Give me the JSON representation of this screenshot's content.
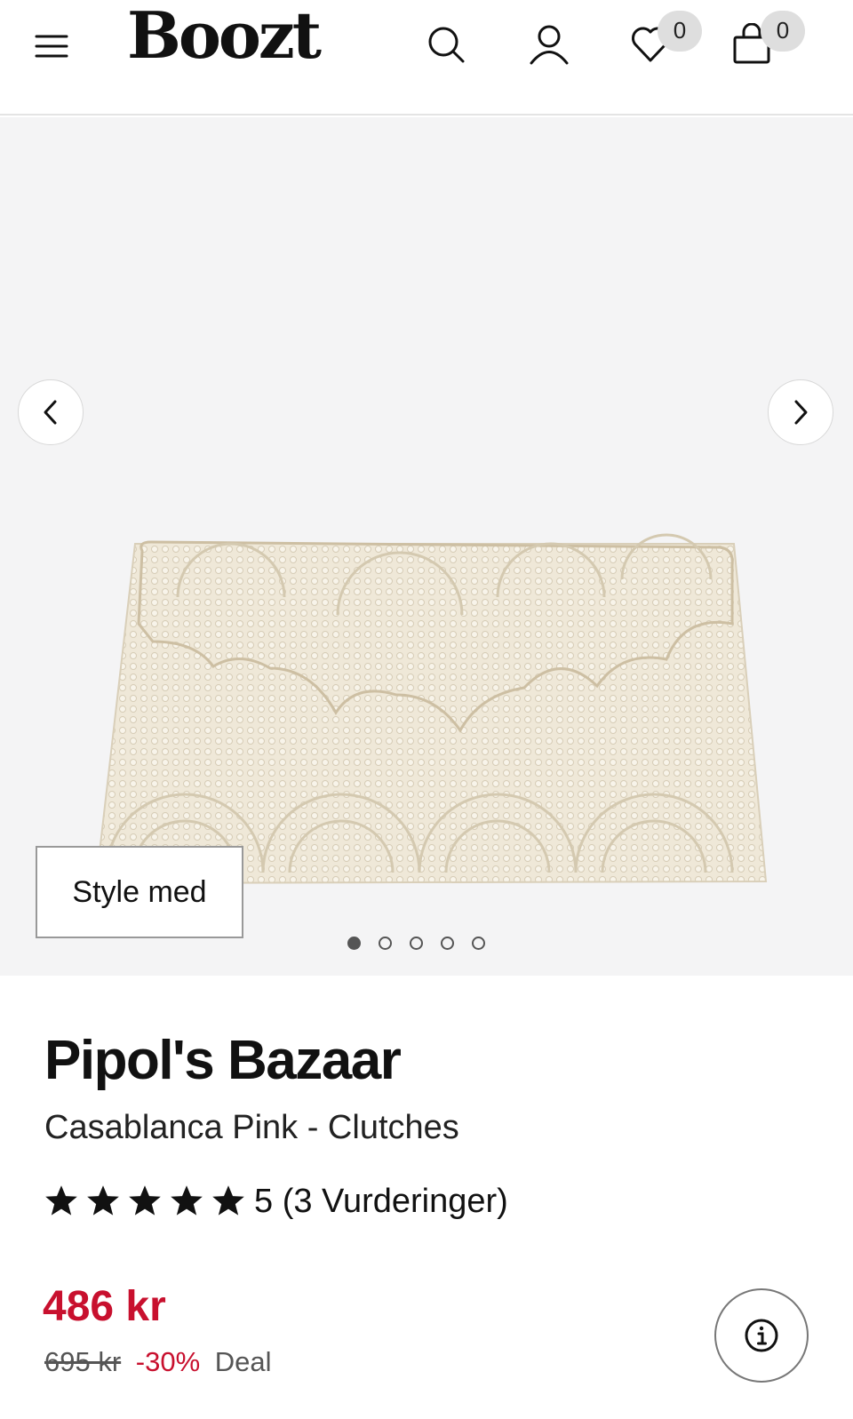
{
  "header": {
    "logo": "Boozt",
    "wishlist_count": "0",
    "cart_count": "0"
  },
  "gallery": {
    "style_button_label": "Style med",
    "dots": [
      true,
      false,
      false,
      false,
      false
    ]
  },
  "product": {
    "brand": "Pipol's Bazaar",
    "name": "Casablanca Pink - Clutches",
    "rating_stars": 5,
    "rating_text": "5 (3 Vurderinger)",
    "price": "486 kr",
    "old_price": "695 kr",
    "discount": "-30%",
    "deal_label": "Deal"
  },
  "colors": {
    "accent_red": "#c8102e",
    "gallery_bg": "#f4f4f5",
    "clutch_beads": "#efe8d8"
  },
  "icons": [
    "menu-icon",
    "search-icon",
    "user-icon",
    "heart-icon",
    "bag-icon",
    "chevron-left-icon",
    "chevron-right-icon",
    "star-icon",
    "info-icon"
  ]
}
